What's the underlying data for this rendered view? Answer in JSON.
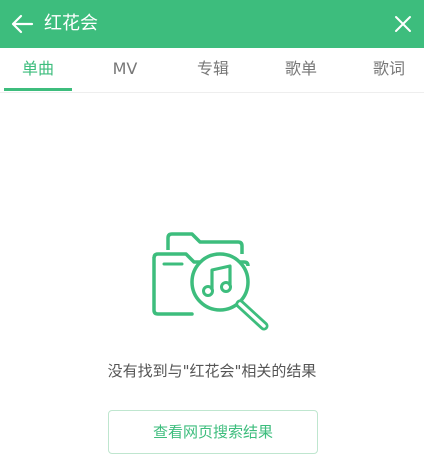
{
  "header": {
    "title": "红花会",
    "background_color": "#3dbd7d",
    "back_icon": "arrow-left-icon",
    "close_icon": "close-icon"
  },
  "tabs": [
    {
      "label": "单曲",
      "active": true
    },
    {
      "label": "MV",
      "active": false
    },
    {
      "label": "专辑",
      "active": false
    },
    {
      "label": "歌单",
      "active": false
    },
    {
      "label": "歌词",
      "active": false
    }
  ],
  "empty_state": {
    "icon": "folder-music-search-icon",
    "message": "没有找到与\"红花会\"相关的结果",
    "action_label": "查看网页搜索结果"
  },
  "colors": {
    "accent": "#3dbd7d",
    "text_secondary": "#777777"
  }
}
